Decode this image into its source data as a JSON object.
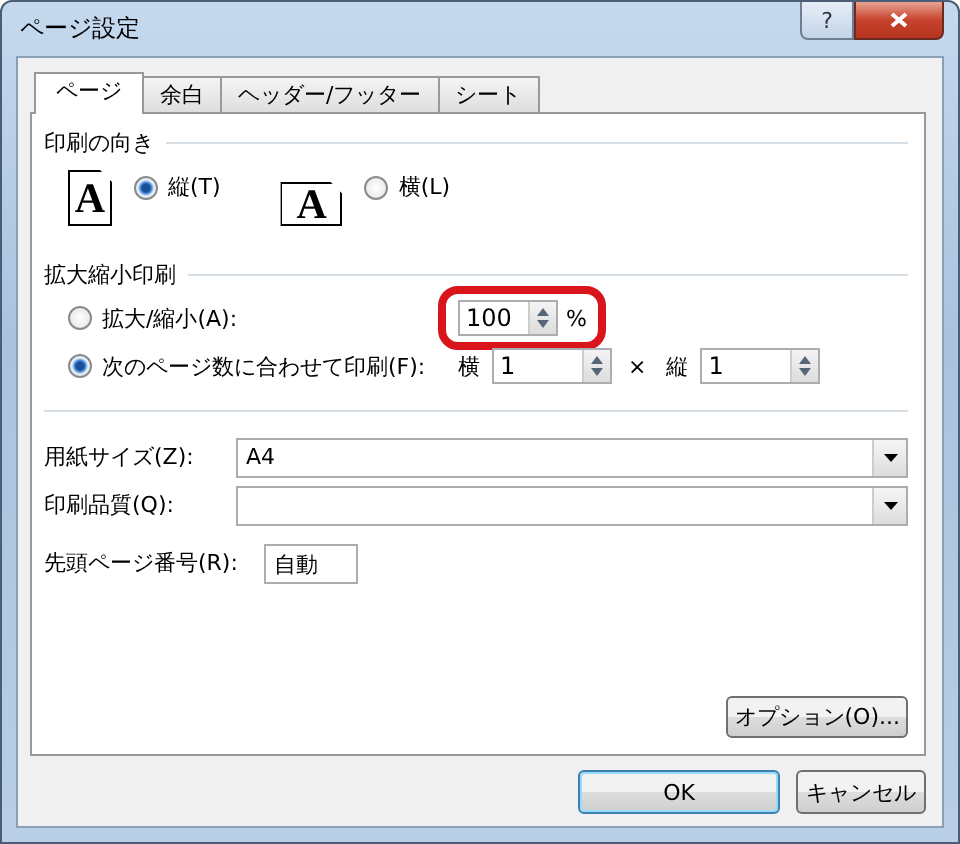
{
  "window": {
    "title": "ページ設定",
    "help": "?"
  },
  "tabs": [
    {
      "label": "ページ",
      "selected": true
    },
    {
      "label": "余白",
      "selected": false
    },
    {
      "label": "ヘッダー/フッター",
      "selected": false
    },
    {
      "label": "シート",
      "selected": false
    }
  ],
  "orientation": {
    "heading": "印刷の向き",
    "options": [
      {
        "kind": "portrait",
        "glyph": "A",
        "label": "縦(T)",
        "selected": true
      },
      {
        "kind": "landscape",
        "glyph": "A",
        "label": "横(L)",
        "selected": false
      }
    ]
  },
  "scaling": {
    "heading": "拡大縮小印刷",
    "options": [
      {
        "kind": "percent",
        "label": "拡大/縮小(A):",
        "selected": false,
        "value": "100",
        "unit": "%",
        "highlighted": true
      },
      {
        "kind": "fit",
        "label": "次のページ数に合わせて印刷(F):",
        "selected": true,
        "wide_label": "横",
        "wide": "1",
        "times": "×",
        "tall_label": "縦",
        "tall": "1"
      }
    ]
  },
  "fields": [
    {
      "kind": "combo",
      "label": "用紙サイズ(Z):",
      "value": "A4"
    },
    {
      "kind": "combo",
      "label": "印刷品質(Q):"
    },
    {
      "kind": "text",
      "label": "先頭ページ番号(R):",
      "value": "自動"
    }
  ],
  "options_button": "オプション(O)...",
  "buttons": [
    {
      "label": "OK",
      "default": true
    },
    {
      "label": "キャンセル",
      "default": false
    }
  ]
}
